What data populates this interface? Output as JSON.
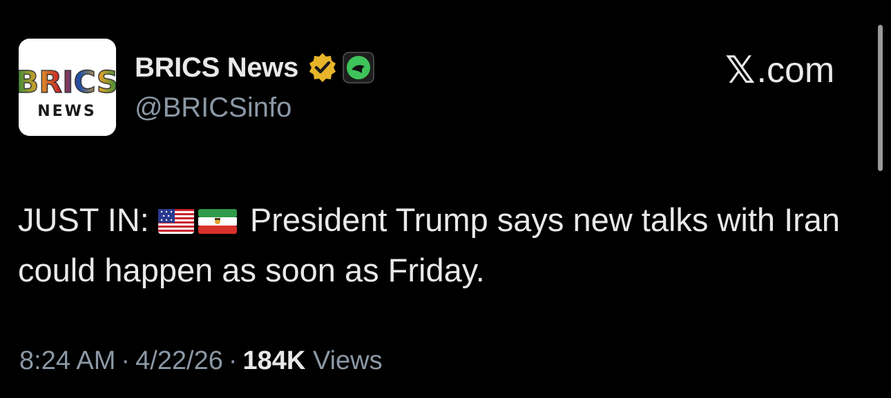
{
  "account": {
    "name": "BRICS News",
    "handle": "@BRICSinfo",
    "avatar_text_top": "BRICS",
    "avatar_text_bottom": "NEWS"
  },
  "brand": {
    "x_glyph": "𝕏",
    "suffix": ".com"
  },
  "tweet": {
    "prefix": "JUST IN:",
    "flags": [
      "us-flag",
      "iran-flag"
    ],
    "body": "President Trump says new talks with Iran could happen as soon as Friday."
  },
  "meta": {
    "time": "8:24 AM",
    "date": "4/22/26",
    "views_count": "184K",
    "views_label": "Views",
    "separator": "·"
  },
  "colors": {
    "background": "#000000",
    "text": "#e7e9ea",
    "secondary": "#8b98a5",
    "verified_gold": "#e8b52a",
    "affiliate_green": "#3ec35a"
  }
}
